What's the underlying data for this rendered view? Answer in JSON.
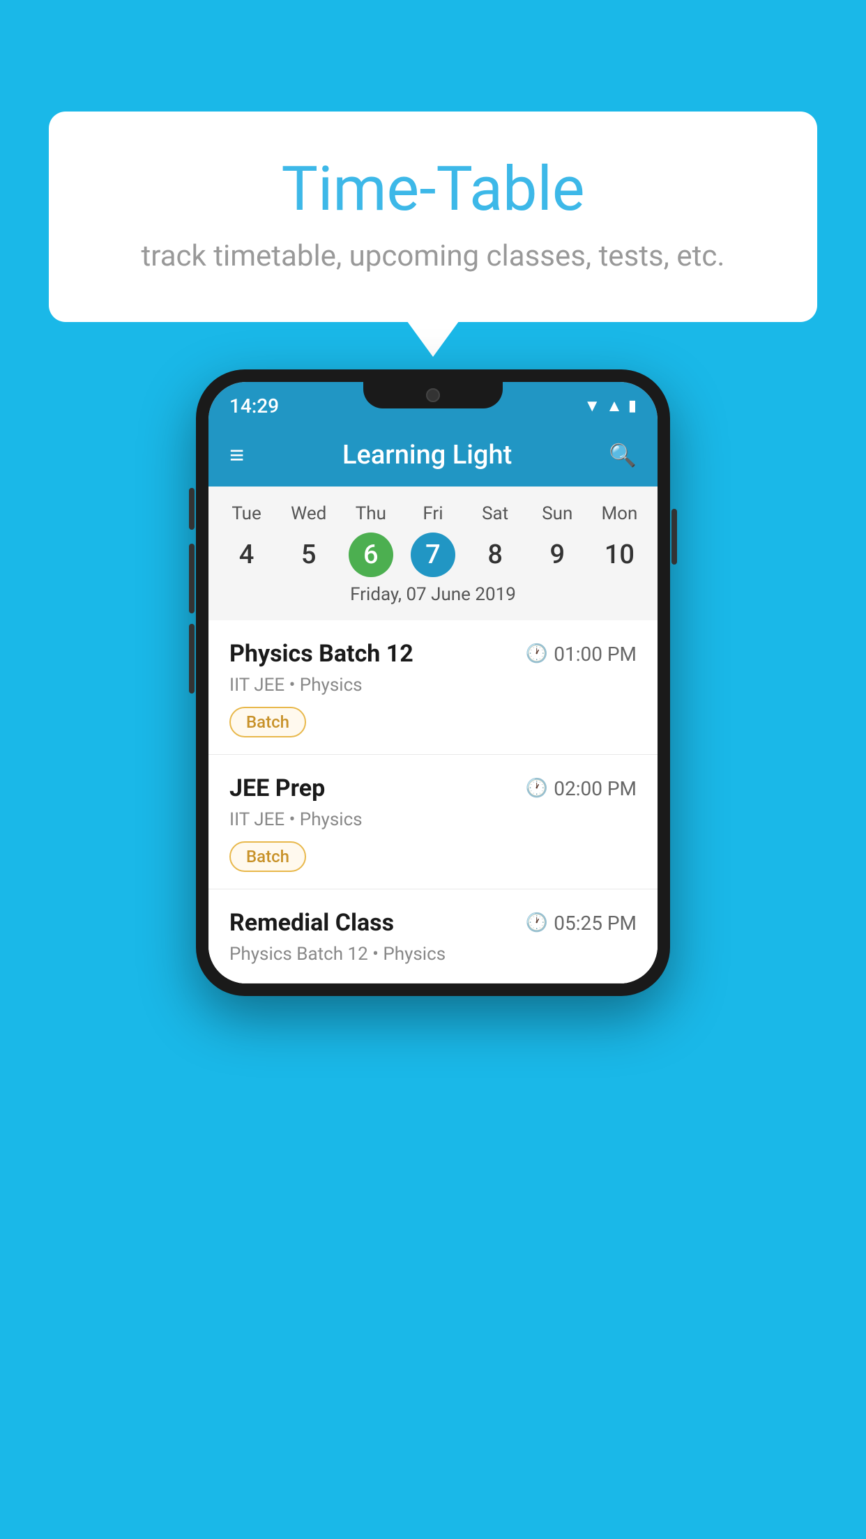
{
  "background_color": "#1ab8e8",
  "bubble": {
    "title": "Time-Table",
    "subtitle": "track timetable, upcoming classes, tests, etc."
  },
  "phone": {
    "status_bar": {
      "time": "14:29"
    },
    "header": {
      "title": "Learning Light",
      "menu_icon": "≡",
      "search_icon": "🔍"
    },
    "calendar": {
      "days": [
        "Tue",
        "Wed",
        "Thu",
        "Fri",
        "Sat",
        "Sun",
        "Mon"
      ],
      "numbers": [
        "4",
        "5",
        "6",
        "7",
        "8",
        "9",
        "10"
      ],
      "today_index": 2,
      "selected_index": 3,
      "selected_label": "Friday, 07 June 2019"
    },
    "events": [
      {
        "name": "Physics Batch 12",
        "time": "01:00 PM",
        "meta": "IIT JEE • Physics",
        "badge": "Batch"
      },
      {
        "name": "JEE Prep",
        "time": "02:00 PM",
        "meta": "IIT JEE • Physics",
        "badge": "Batch"
      },
      {
        "name": "Remedial Class",
        "time": "05:25 PM",
        "meta": "Physics Batch 12 • Physics",
        "badge": null
      }
    ]
  }
}
